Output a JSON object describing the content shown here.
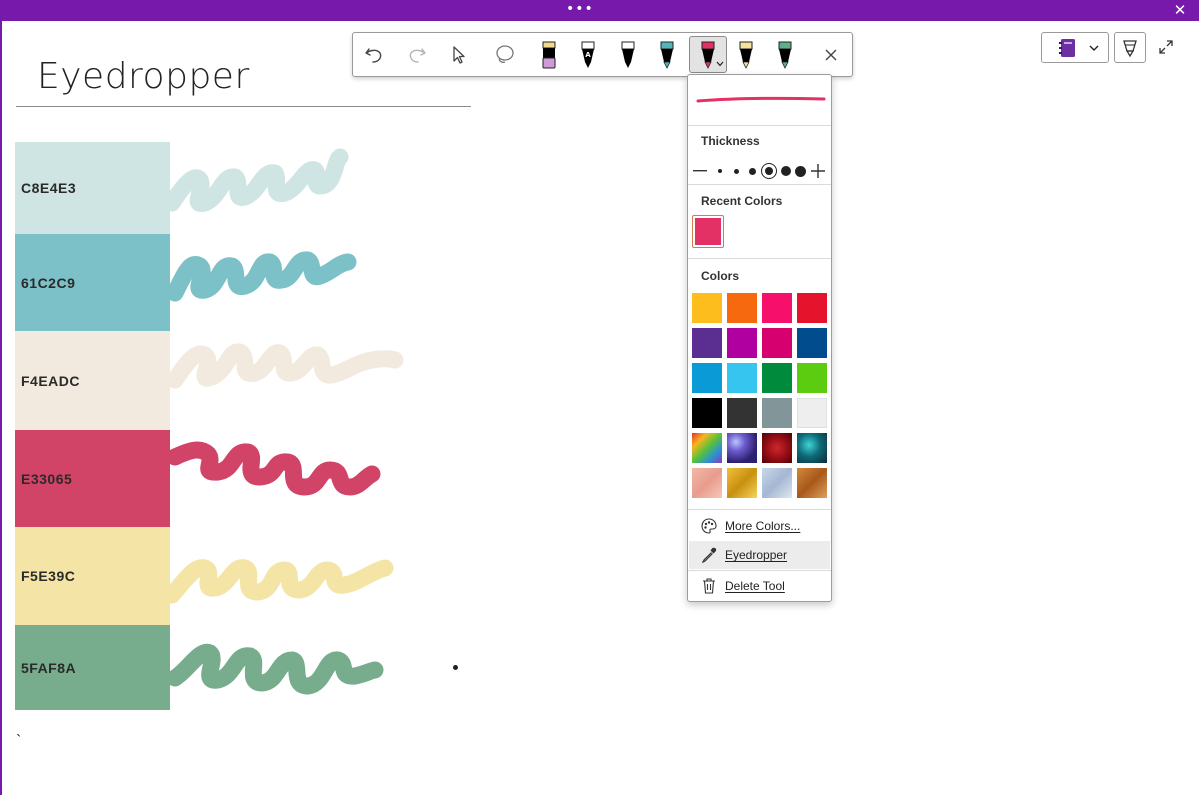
{
  "window": {
    "title_dots": "•••",
    "close_glyph": "✕"
  },
  "page": {
    "title": "Eyedropper",
    "footer_char": "`"
  },
  "swatches": [
    {
      "hex": "C8E4E3",
      "color": "#cfe5e4"
    },
    {
      "hex": "61C2C9",
      "color": "#7cc1c8"
    },
    {
      "hex": "F4EADC",
      "color": "#f3eadf"
    },
    {
      "hex": "E33065",
      "color": "#d24467"
    },
    {
      "hex": "F5E39C",
      "color": "#f4e5a6"
    },
    {
      "hex": "5FAF8A",
      "color": "#77ad8d"
    }
  ],
  "toolbar": {
    "items": [
      "undo-icon",
      "redo-icon",
      "select-objects-icon",
      "lasso-select-icon",
      "highlighter-pen-icon",
      "text-pen-icon",
      "black-pen-icon",
      "teal-pen-icon",
      "pink-pen-icon",
      "yellow-pen-icon",
      "green-pen-icon",
      "close-icon"
    ],
    "selected": "pink-pen-icon"
  },
  "pen_panel": {
    "ink_color": "#e33065",
    "thickness_label": "Thickness",
    "recent_colors_label": "Recent Colors",
    "recent_colors": [
      "#e33065"
    ],
    "colors_label": "Colors",
    "colors": [
      "#fdbd1c",
      "#f7690f",
      "#f70f6c",
      "#e5132c",
      "#5b2e91",
      "#b0009f",
      "#d6006e",
      "#004c8d",
      "#0a9ad6",
      "#35c5ef",
      "#008a3b",
      "#5ccc10",
      "#000000",
      "#333333",
      "#829598",
      "#eeeeee"
    ],
    "texture_colors": [
      "rainbow",
      "galaxy",
      "red-lava",
      "ocean",
      "rose-gold",
      "gold",
      "silver",
      "bronze"
    ],
    "menu": [
      {
        "label": "More Colors...",
        "icon": "palette-icon"
      },
      {
        "label": "Eyedropper",
        "icon": "eyedropper-icon"
      },
      {
        "label": "Delete Tool",
        "icon": "trash-icon"
      }
    ]
  }
}
